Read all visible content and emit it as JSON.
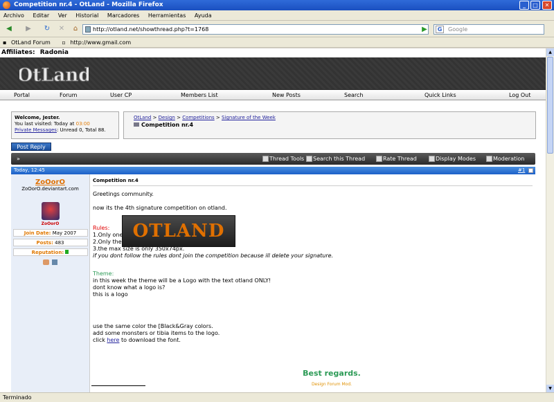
{
  "window": {
    "title": "Competition nr.4 - OtLand - Mozilla Firefox",
    "buttons": [
      "_",
      "□",
      "✕"
    ]
  },
  "menu": [
    "Archivo",
    "Editar",
    "Ver",
    "Historial",
    "Marcadores",
    "Herramientas",
    "Ayuda"
  ],
  "toolbar": {
    "url": "http://otland.net/showthread.php?t=1768",
    "search_placeholder": "Google"
  },
  "bookmarks": [
    "OtLand Forum",
    "http://www.gmail.com"
  ],
  "status": "Terminado",
  "page": {
    "affiliates_label": "Affiliates:",
    "affiliates_value": "Radonia",
    "logo_text": "OtLand",
    "nav": [
      "Portal",
      "Forum",
      "User CP",
      "Members List",
      "New Posts",
      "Search",
      "Quick Links",
      "Log Out"
    ],
    "welcome": {
      "line1": "Welcome, Jester.",
      "line2_prefix": "You last visited: Today at",
      "line2_time": "03:00",
      "line3_link": "Private Messages",
      "line3_rest": ": Unread 0, Total 88."
    },
    "breadcrumb": {
      "items": [
        "OtLand",
        "Design",
        "Competitions",
        "Signature of the Week"
      ],
      "sep": ">",
      "current": "Competition nr.4"
    },
    "post_reply": "Post Reply",
    "thread_tools": [
      "Thread Tools",
      "Search this Thread",
      "Rate Thread",
      "Display Modes",
      "Moderation"
    ],
    "post": {
      "date": "Today, 12:45",
      "number": "#1",
      "user": {
        "name": "ZoOorO",
        "site": "ZoOorO.deviantart.com",
        "avatar_text": "ZoOorO",
        "stats": [
          {
            "label": "Join Date:",
            "value": "May 2007"
          },
          {
            "label": "Posts:",
            "value": "483"
          },
          {
            "label": "Reputation:",
            "value": ""
          }
        ]
      },
      "title": "Competition nr.4",
      "greeting": "Greetings community.",
      "intro": "now its the 4th signature competition on otland.",
      "rules_title": "Rules:",
      "rules": [
        "1.Only one attachment per member.",
        "2.Only the theme that im going to tell you.",
        "3.the max size is only 350x74px."
      ],
      "rules_note": "if you dont follow the rules dont join the competition because ill delete your signature.",
      "theme_title": "Theme:",
      "theme_lines": [
        "in this week the theme will be a Logo with the text otland ONLY!",
        "dont know what a logo is?",
        "this is a logo"
      ],
      "logo_image_text": "OTLAND",
      "after_lines": [
        "use the same color the [Black&Gray colors.",
        "add some monsters or tibia items to the logo."
      ],
      "click_prefix": "click",
      "click_link": "here",
      "click_suffix": "to download the font.",
      "regards": "Best regards.",
      "signature": "Design Forum Mod."
    }
  }
}
